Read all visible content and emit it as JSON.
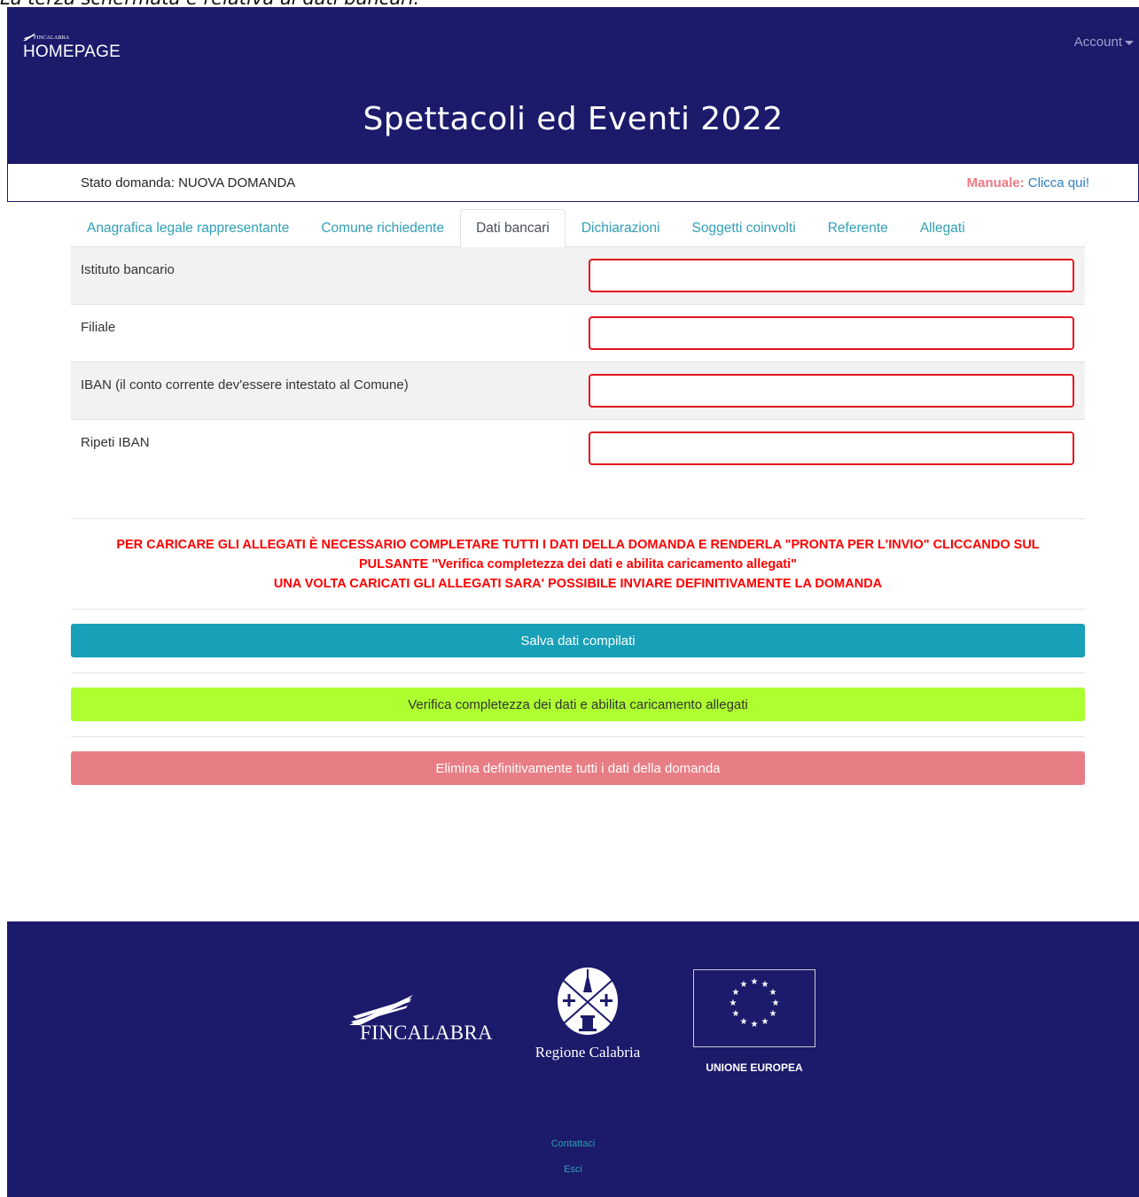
{
  "caption": "La terza schermata è relativa ai dati bancari:",
  "header": {
    "brand_small": "FINCALABRA",
    "brand_title": "HOMEPAGE",
    "account_label": "Account",
    "page_title": "Spettacoli ed Eventi 2022"
  },
  "status": {
    "text": "Stato domanda: NUOVA DOMANDA",
    "manual_label": "Manuale:",
    "manual_link": "Clicca qui!"
  },
  "tabs": [
    {
      "label": "Anagrafica legale rappresentante",
      "active": false
    },
    {
      "label": "Comune richiedente",
      "active": false
    },
    {
      "label": "Dati bancari",
      "active": true
    },
    {
      "label": "Dichiarazioni",
      "active": false
    },
    {
      "label": "Soggetti coinvolti",
      "active": false
    },
    {
      "label": "Referente",
      "active": false
    },
    {
      "label": "Allegati",
      "active": false
    }
  ],
  "form": {
    "fields": [
      {
        "label": "Istituto bancario",
        "value": ""
      },
      {
        "label": "Filiale",
        "value": ""
      },
      {
        "label": "IBAN (il conto corrente dev'essere intestato al Comune)",
        "value": ""
      },
      {
        "label": "Ripeti IBAN",
        "value": ""
      }
    ]
  },
  "warning": {
    "line1": "PER CARICARE GLI ALLEGATI È NECESSARIO COMPLETARE TUTTI I DATI DELLA DOMANDA E RENDERLA \"PRONTA PER L'INVIO\" CLICCANDO SUL",
    "line2": "PULSANTE \"Verifica completezza dei dati e abilita caricamento allegati\"",
    "line3": "UNA VOLTA CARICATI GLI ALLEGATI SARA' POSSIBILE INVIARE DEFINITIVAMENTE LA DOMANDA"
  },
  "buttons": {
    "save": "Salva dati compilati",
    "verify": "Verifica completezza dei dati e abilita caricamento allegati",
    "delete": "Elimina definitivamente tutti i dati della domanda"
  },
  "footer": {
    "fincalabra_logo": "FINCALABRA",
    "regione_logo": "Regione Calabria",
    "ue_logo": "UNIONE EUROPEA",
    "contact_link": "Contattaci",
    "exit_link": "Esci"
  },
  "colors": {
    "navy": "#1b1a6b",
    "teal": "#17a0b7",
    "lime": "#adff2f",
    "danger_light": "#e87e85",
    "error_border": "#e2161f"
  }
}
